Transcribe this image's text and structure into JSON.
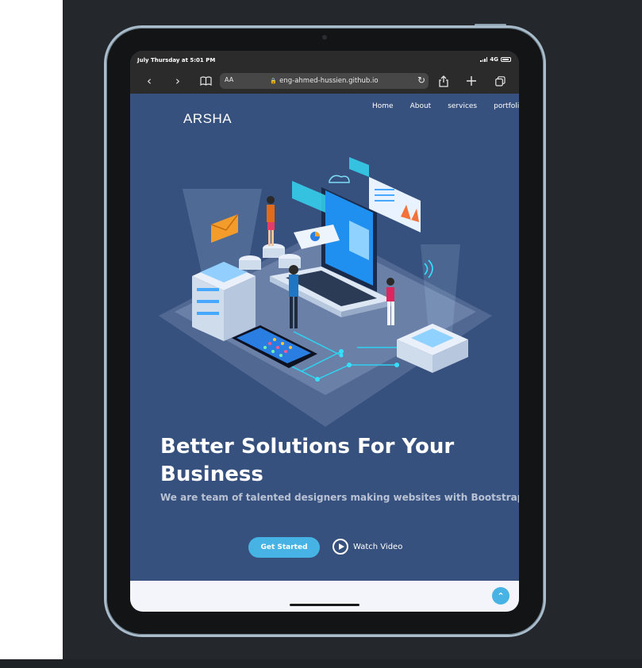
{
  "status": {
    "time": "July Thursday at 5:01 PM",
    "network": "4G"
  },
  "browser": {
    "text_size": "AA",
    "url": "eng-ahmed-hussien.github.io"
  },
  "site": {
    "brand": "ARSHA",
    "nav": [
      "Home",
      "About",
      "services",
      "portfolio"
    ],
    "hero_title": "Better Solutions For Your Business",
    "hero_subtitle": "We are team of talented designers making websites with Bootstrap",
    "get_started": "Get Started",
    "watch_video": "Watch Video"
  },
  "colors": {
    "hero_bg": "#37517e",
    "accent": "#47b2e4",
    "below_bg": "#f3f5fa",
    "device_frame": "#a9bccb"
  },
  "icons": [
    "back-icon",
    "forward-icon",
    "bookmarks-icon",
    "lock-icon",
    "reload-icon",
    "share-icon",
    "new-tab-icon",
    "tabs-icon",
    "play-icon",
    "back-to-top-icon"
  ]
}
